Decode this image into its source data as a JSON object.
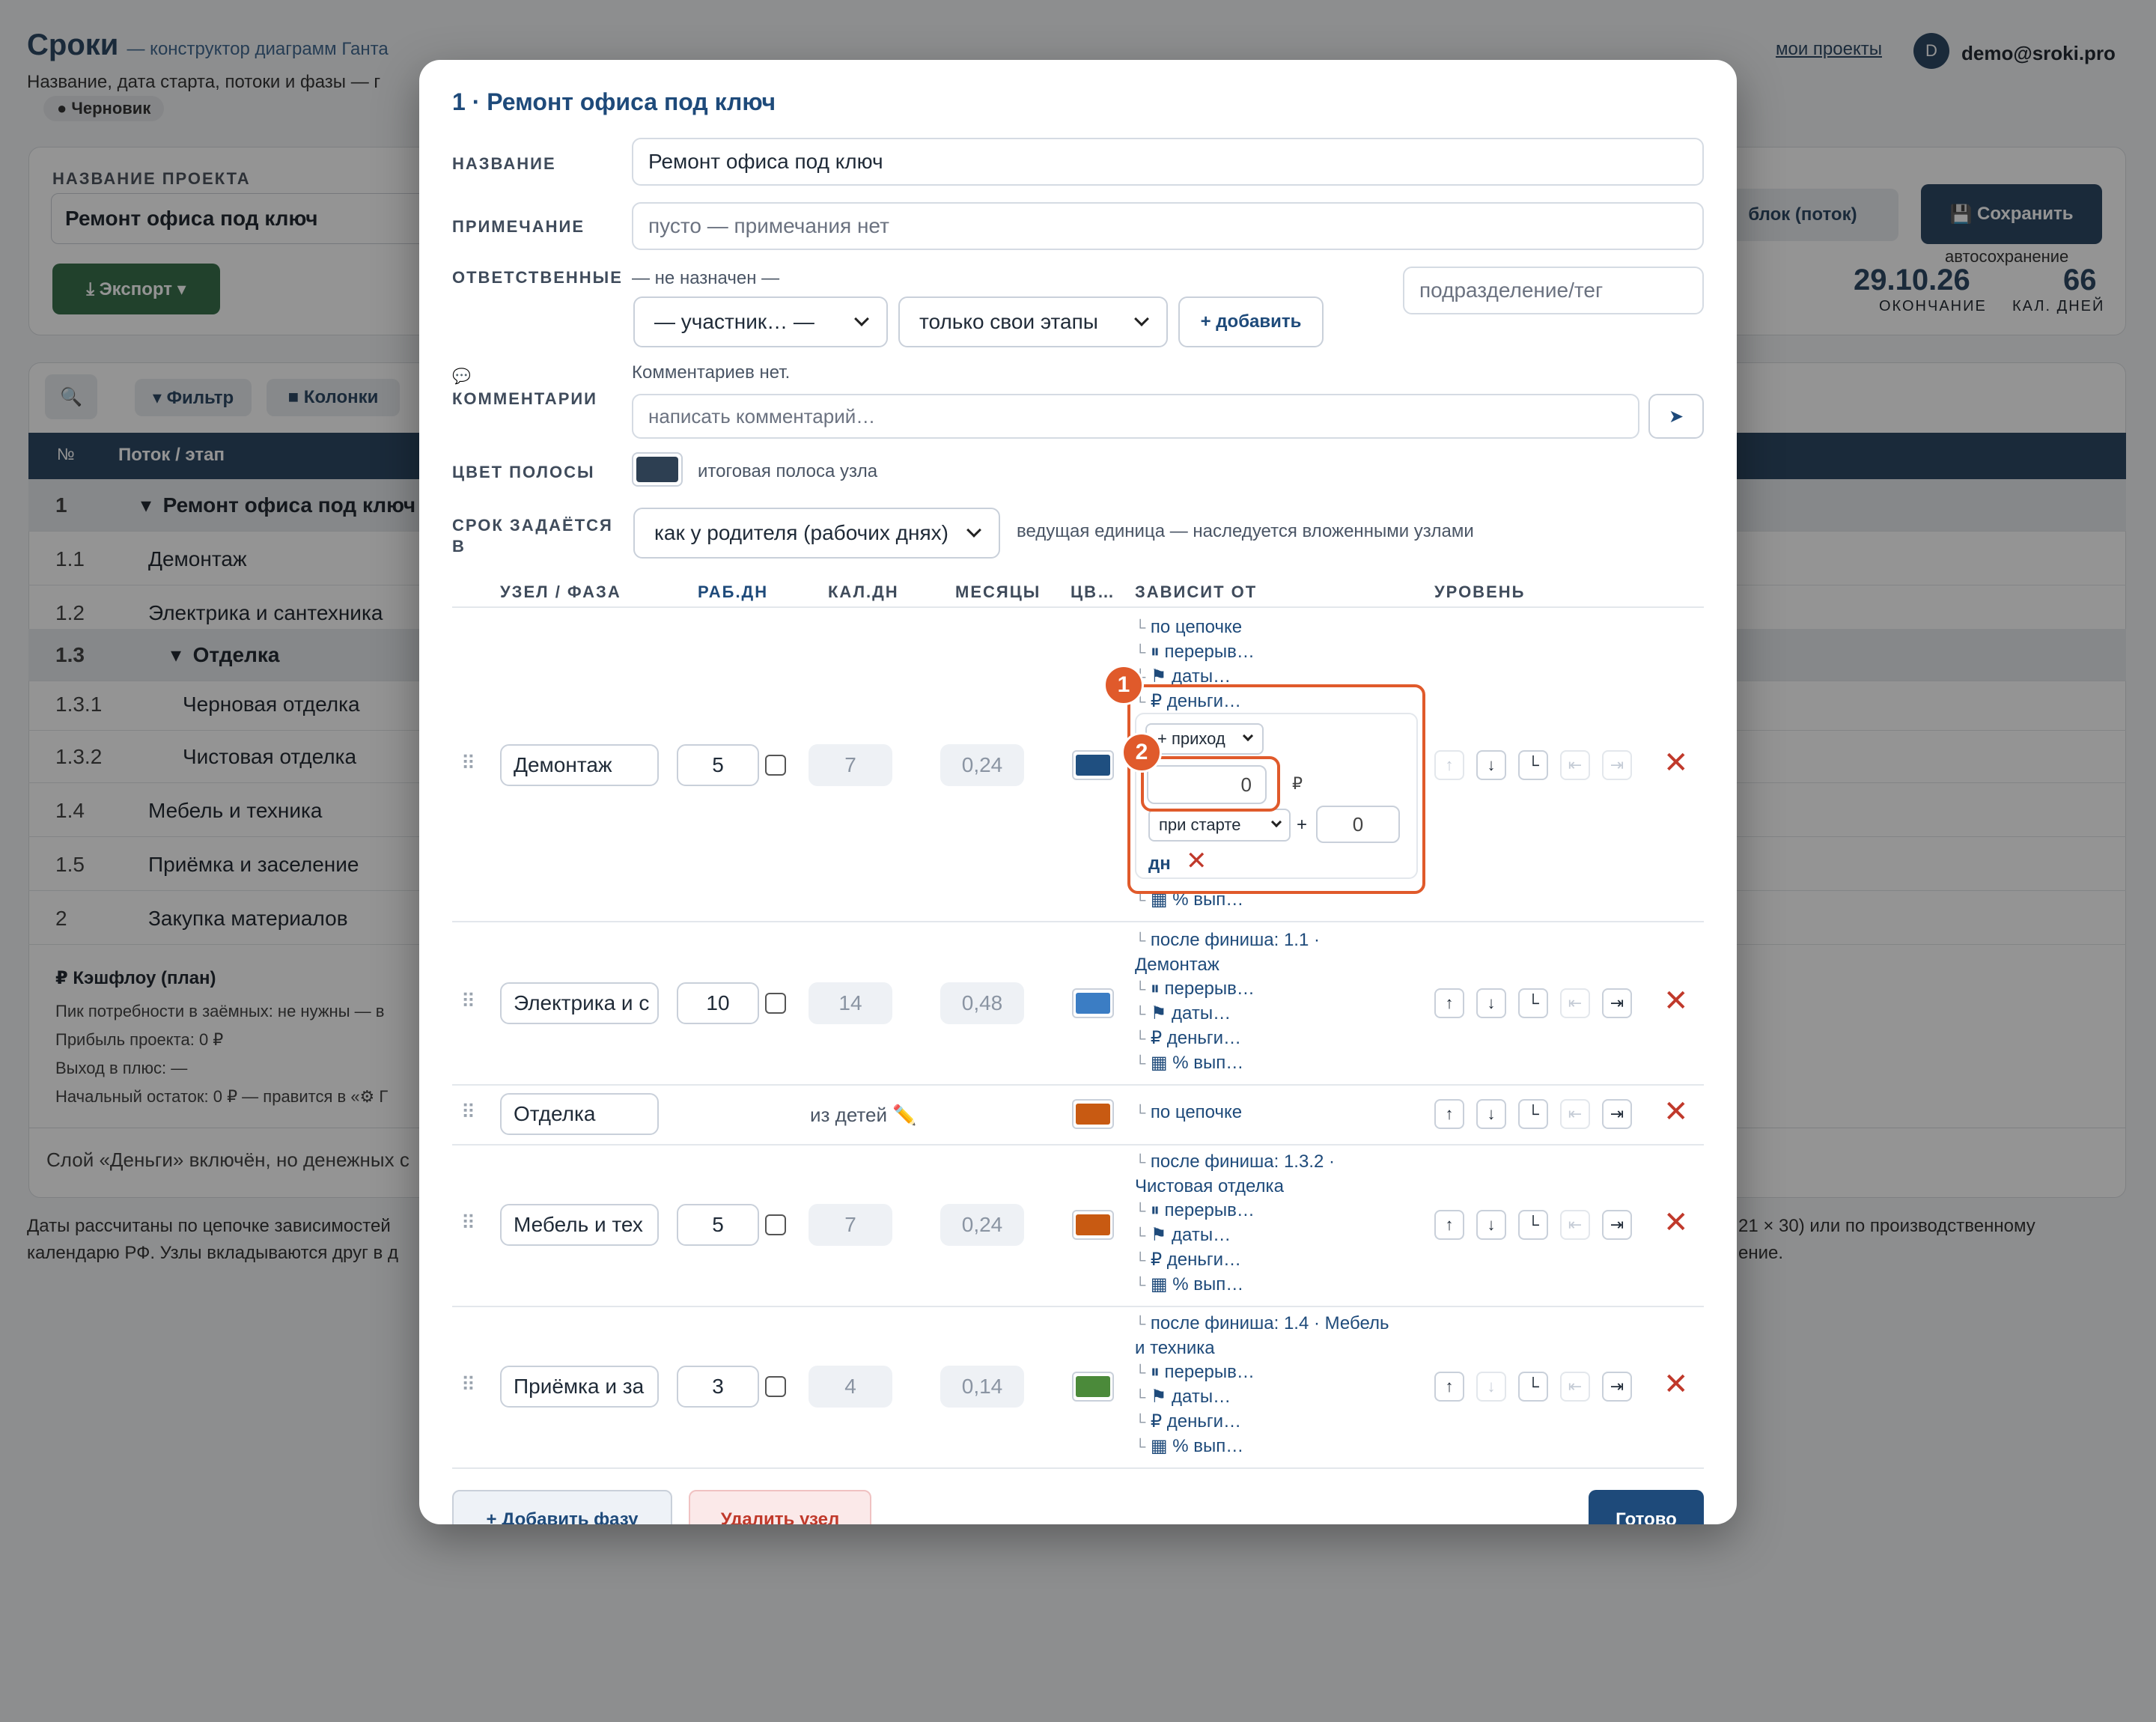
{
  "app": {
    "brand": "Сроки",
    "tagline": "— конструктор диаграмм Ганта",
    "subtitle": "Название, дата старта, потоки и фазы — г",
    "status_badge": "Черновик",
    "my_projects": "мои проекты",
    "user_initial": "D",
    "user_email": "demo@sroki.pro"
  },
  "background": {
    "project_name_label": "НАЗВАНИЕ ПРОЕКТА",
    "project_name_value": "Ремонт офиса под ключ",
    "export_button": "⤓ Экспорт ▾",
    "add_block_button": "блок (поток)",
    "save_button": "Сохранить",
    "autosave": "автосохранение",
    "end_date": "29.10.26",
    "end_label": "ОКОНЧАНИЕ",
    "cal_days": "66",
    "cal_days_label": "КАЛ. ДНЕЙ",
    "filter_button": "▾ Фильтр",
    "columns_button": "Колонки",
    "col_num": "№",
    "col_stream": "Поток / этап",
    "rows": [
      {
        "num": "1",
        "name": "Ремонт офиса под ключ"
      },
      {
        "num": "1.1",
        "name": "Демонтаж"
      },
      {
        "num": "1.2",
        "name": "Электрика и сантехника"
      },
      {
        "num": "1.3",
        "name": "Отделка"
      },
      {
        "num": "1.3.1",
        "name": "Черновая отделка"
      },
      {
        "num": "1.3.2",
        "name": "Чистовая отделка"
      },
      {
        "num": "1.4",
        "name": "Мебель и техника"
      },
      {
        "num": "1.5",
        "name": "Приёмка и заселение"
      },
      {
        "num": "2",
        "name": "Закупка материалов"
      }
    ],
    "cashflow_title": "₽ Кэшфлоу (план)",
    "cashflow_lines": [
      "Пик потребности в заёмных: не нужны — в",
      "Прибыль проекта: 0 ₽",
      "Выход в плюс: —",
      "Начальный остаток: 0 ₽ — правится в «⚙ Г"
    ],
    "money_note": "Слой «Деньги» включён, но денежных с",
    "footer_line1": "Даты рассчитаны по цепочке зависимостей",
    "footer_line1_right": "21 × 30) или по производственному",
    "footer_line2": "календарю РФ. Узлы вкладываются друг в д",
    "footer_line2_right": "ение."
  },
  "modal": {
    "title": "1 · Ремонт офиса под ключ",
    "name_label": "НАЗВАНИЕ",
    "name_value": "Ремонт офиса под ключ",
    "note_label": "ПРИМЕЧАНИЕ",
    "note_placeholder": "пусто — примечания нет",
    "resp_label": "ОТВЕТСТВЕННЫЕ",
    "resp_none": "— не назначен —",
    "participant_select": "— участник… —",
    "scope_select": "только свои этапы",
    "add_button": "+ добавить",
    "dept_placeholder": "подразделение/тег",
    "comments_label": "КОММЕНТАРИИ",
    "comments_empty": "Комментариев нет.",
    "comment_placeholder": "написать комментарий…",
    "send_icon": "➤",
    "bar_color_label": "ЦВЕТ ПОЛОСЫ",
    "bar_color": "#2d3f52",
    "bar_color_hint": "итоговая полоса узла",
    "units_label": "СРОК ЗАДАЁТСЯ В",
    "units_select": "как у родителя (рабочих днях)",
    "units_hint": "ведущая единица — наследуется вложенными узлами",
    "columns": {
      "phase": "УЗЕЛ / ФАЗА",
      "work_days": "РАБ.ДН",
      "cal_days": "КАЛ.ДН",
      "months": "МЕСЯЦЫ",
      "color": "ЦВ…",
      "depends": "ЗАВИСИТ ОТ",
      "level": "УРОВЕНЬ"
    },
    "phases": [
      {
        "name": "Демонтаж",
        "work": "5",
        "cal": "7",
        "months": "0,24",
        "color": "#1f4f80",
        "deps": [
          "по цепочке",
          "⏸ перерыв…",
          "⚑ даты…",
          "₽ деньги…"
        ],
        "deps_tail": "▦ % вып…"
      },
      {
        "name": "Электрика и с",
        "work": "10",
        "cal": "14",
        "months": "0,48",
        "color": "#3b7dc4",
        "deps": [
          "после финиша: 1.1 ·",
          "Демонтаж",
          "⏸ перерыв…",
          "⚑ даты…",
          "₽ деньги…",
          "▦ % вып…"
        ]
      },
      {
        "name": "Отделка",
        "from_children": "из детей ✏️",
        "color": "#c85a12",
        "deps": [
          "по цепочке"
        ]
      },
      {
        "name": "Мебель и тех",
        "work": "5",
        "cal": "7",
        "months": "0,24",
        "color": "#c85a12",
        "deps": [
          "после финиша: 1.3.2 ·",
          "Чистовая отделка",
          "⏸ перерыв…",
          "⚑ даты…",
          "₽ деньги…",
          "▦ % вып…"
        ]
      },
      {
        "name": "Приёмка и за",
        "work": "3",
        "cal": "4",
        "months": "0,14",
        "color": "#4b8a3a",
        "deps": [
          "после финиша: 1.4 · Мебель",
          "и техника",
          "⏸ перерыв…",
          "⚑ даты…",
          "₽ деньги…",
          "▦ % вып…"
        ]
      }
    ],
    "money_popup": {
      "type_select": "+ приход",
      "amount": "0",
      "currency": "₽",
      "when_select": "при старте",
      "plus": "+",
      "offset": "0",
      "unit": "дн",
      "callout_1": "1",
      "callout_2": "2"
    },
    "add_phase_button": "+ Добавить фазу",
    "delete_node_button": "Удалить узел",
    "done_button": "Готово"
  }
}
